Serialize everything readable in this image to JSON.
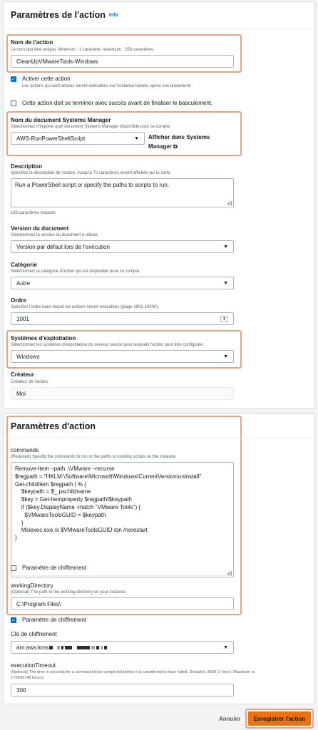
{
  "section1": {
    "title": "Paramètres de l'action",
    "info": "Info",
    "action_name": {
      "label": "Nom de l'action",
      "desc": "Le nom doit être unique. Minimum : 1 caractère, maximum : 256 caractères.",
      "value": "CleanUpVMwareTools-Windows"
    },
    "activate": {
      "label": "Activer cette action",
      "desc": "Les actions qui sont actives seront exécutées sur l'instance lancée, après son lancement.",
      "checked": true
    },
    "must_succeed": {
      "label": "Cette action doit se terminer avec succès avant de finaliser le basculement.",
      "checked": false
    },
    "ssm_doc": {
      "label": "Nom du document Systems Manager",
      "desc": "Sélectionnez n'importe quel document Systems Manager disponible pour ce compte.",
      "value": "AWS-RunPowerShellScript",
      "link_line1": "Afficher dans Systems",
      "link_line2": "Manager"
    },
    "description": {
      "label": "Description",
      "desc": "Spécifiez la description de l'action. Jusqu'à 70 caractères seront affichés sur la carte.",
      "value": "Run a PowerShell script or specify the paths to scripts to run.",
      "counter": "193 caractères restants"
    },
    "doc_version": {
      "label": "Version du document",
      "desc": "Sélectionnez la version du document à utiliser.",
      "value": "Version par défaut lors de l'exécution"
    },
    "category": {
      "label": "Catégorie",
      "desc": "Sélectionnez la catégorie d'action qui est disponible pour ce compte.",
      "value": "Autre"
    },
    "order": {
      "label": "Ordre",
      "desc": "Spécifiez l'ordre dans lequel les actions seront exécutées (plage 1001-10000).",
      "value": "1001"
    },
    "os": {
      "label": "Systèmes d'exploitation",
      "desc": "Sélectionnez les systèmes d'exploitation du serveur source pour lesquels l'action peut être configurée.",
      "value": "Windows"
    },
    "creator": {
      "label": "Créateur",
      "desc": "Créateur de l'action.",
      "value": "Moi"
    }
  },
  "section2": {
    "title": "Paramètres d'action",
    "commands": {
      "label": "commands",
      "desc": "(Required) Specify the commands to run or the paths to existing scripts on the instance.",
      "lines": [
        "Remove-Item –path .\\VMware –recurse",
        "$regpath = \"HKLM:\\Software\\Microsoft\\Windows\\CurrentVersion\\uninstall\"",
        "Get-childItem $regpath | % {",
        "    $keypath = $_.pschildname",
        "    $key = Get-Itemproperty $regpath\\$keypath",
        "    if ($key.DisplayName -match \"VMware Tools\") {",
        "      $VMwareToolsGUID = $keypath",
        "    }",
        "    Msiexec.exe /x $VMwareToolsGUID /qn /norestart",
        "}"
      ]
    },
    "encrypt1": {
      "label": "Paramètre de chiffrement",
      "checked": false
    },
    "workdir": {
      "label": "workingDirectory",
      "desc": "(Optional) The path to the working directory on your instance.",
      "value": "C:\\Program Files\\"
    },
    "encrypt2": {
      "label": "Paramètre de chiffrement",
      "checked": true
    },
    "key": {
      "label": "Clé de chiffrement",
      "value_prefix": "arn:aws:kms"
    },
    "timeout": {
      "label": "executionTimeout",
      "desc1": "(Optional) The time in seconds for a command to be completed before it is considered to have failed. Default is 3600 (1 hour). Maximum is",
      "desc2": "172800 (48 hours).",
      "value": "300"
    }
  },
  "footer": {
    "cancel": "Annuler",
    "save": "Enregistrer l'action"
  },
  "colors": {
    "highlight": "#e9a383",
    "primary": "#ec7211",
    "checkbox": "#0073bb",
    "link": "#0073bb"
  }
}
